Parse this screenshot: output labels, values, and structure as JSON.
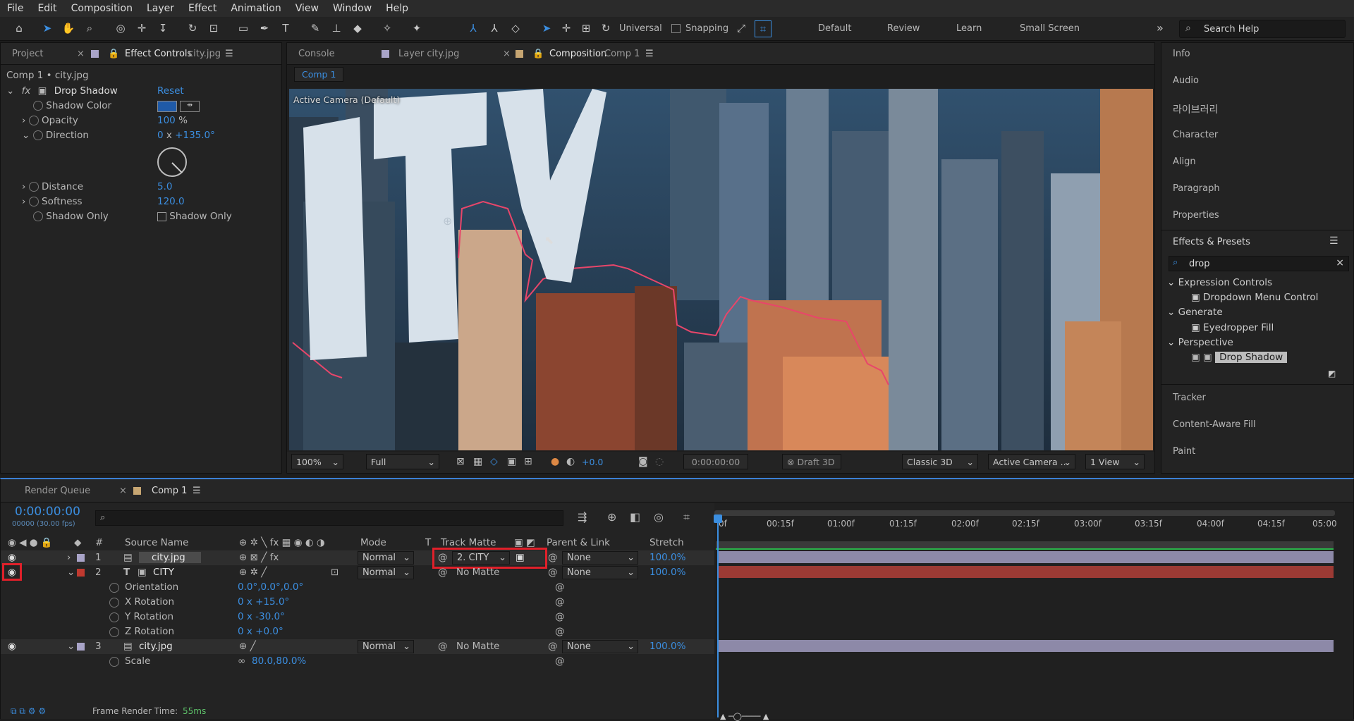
{
  "menu": [
    "File",
    "Edit",
    "Composition",
    "Layer",
    "Effect",
    "Animation",
    "View",
    "Window",
    "Help"
  ],
  "toolbar": {
    "universal": "Universal",
    "snapping": "Snapping",
    "workspaces": [
      "Default",
      "Review",
      "Learn",
      "Small Screen"
    ],
    "search_placeholder": "Search Help"
  },
  "left_panel": {
    "tabs": {
      "project": "Project",
      "effect_controls": "Effect Controls",
      "effect_controls_layer": "city.jpg"
    },
    "crumb": "Comp 1 • city.jpg",
    "effect_name": "Drop Shadow",
    "reset": "Reset",
    "props": {
      "shadow_color": "Shadow Color",
      "opacity": "Opacity",
      "opacity_value": "100",
      "opacity_unit": "%",
      "direction": "Direction",
      "direction_turns": "0",
      "direction_x": "x",
      "direction_value": "+135.0°",
      "distance": "Distance",
      "distance_value": "5.0",
      "softness": "Softness",
      "softness_value": "120.0",
      "shadow_only": "Shadow Only",
      "shadow_only_checkbox": "Shadow Only"
    },
    "shadow_color_hex": "#1f5aa8"
  },
  "viewer": {
    "tabs": {
      "console": "Console",
      "layer": "Layer city.jpg",
      "composition": "Composition",
      "comp_name": "Comp 1"
    },
    "comp_chip": "Comp 1",
    "camera_label": "Active Camera (Default)",
    "text_letters": "ITY",
    "bottom": {
      "zoom": "100%",
      "quality": "Full",
      "exposure": "+0.0",
      "timecode": "0:00:00:00",
      "draft3d": "Draft 3D",
      "renderer": "Classic 3D",
      "camera": "Active Camera ...",
      "views": "1 View"
    }
  },
  "right_panel": {
    "items": [
      "Info",
      "Audio",
      "라이브러리",
      "Character",
      "Align",
      "Paragraph",
      "Properties"
    ],
    "effects_title": "Effects & Presets",
    "search_value": "drop",
    "tree": [
      {
        "group": "Expression Controls",
        "item": "Dropdown Menu Control"
      },
      {
        "group": "Generate",
        "item": "Eyedropper Fill"
      },
      {
        "group": "Perspective",
        "item": "Drop Shadow"
      }
    ],
    "items_bottom": [
      "Tracker",
      "Content-Aware Fill",
      "Paint"
    ]
  },
  "timeline": {
    "tabs": {
      "render_queue": "Render Queue",
      "comp": "Comp 1"
    },
    "timecode": "0:00:00:00",
    "frames": "00000 (30.00 fps)",
    "headers": {
      "num": "#",
      "source": "Source Name",
      "mode": "Mode",
      "t": "T",
      "matte": "Track Matte",
      "parent": "Parent & Link",
      "stretch": "Stretch"
    },
    "ruler": [
      "0f",
      "00:15f",
      "01:00f",
      "01:15f",
      "02:00f",
      "02:15f",
      "03:00f",
      "03:15f",
      "04:00f",
      "04:15f",
      "05:00"
    ],
    "layers": [
      {
        "num": "1",
        "name": "city.jpg",
        "mode": "Normal",
        "matte": "2. CITY",
        "parent": "None",
        "stretch": "100.0%"
      },
      {
        "num": "2",
        "name": "CITY",
        "mode": "Normal",
        "matte": "No Matte",
        "parent": "None",
        "stretch": "100.0%"
      },
      {
        "num": "3",
        "name": "city.jpg",
        "mode": "Normal",
        "matte": "No Matte",
        "parent": "None",
        "stretch": "100.0%"
      }
    ],
    "props2": [
      {
        "name": "Orientation",
        "value": "0.0°,0.0°,0.0°"
      },
      {
        "name": "X Rotation",
        "value": "0 x +15.0°"
      },
      {
        "name": "Y Rotation",
        "value": "0 x -30.0°"
      },
      {
        "name": "Z Rotation",
        "value": "0 x +0.0°"
      }
    ],
    "props3": [
      {
        "name": "Scale",
        "value": "80.0,80.0%"
      }
    ],
    "footer": {
      "label": "Frame Render Time:",
      "value": "55ms"
    },
    "colors": {
      "layer1": "#a9a4c8",
      "layer2": "#c0392f",
      "layer3": "#a9a4c8",
      "bar_light": "#8d89a8",
      "bar_red": "#9c3a34"
    }
  }
}
